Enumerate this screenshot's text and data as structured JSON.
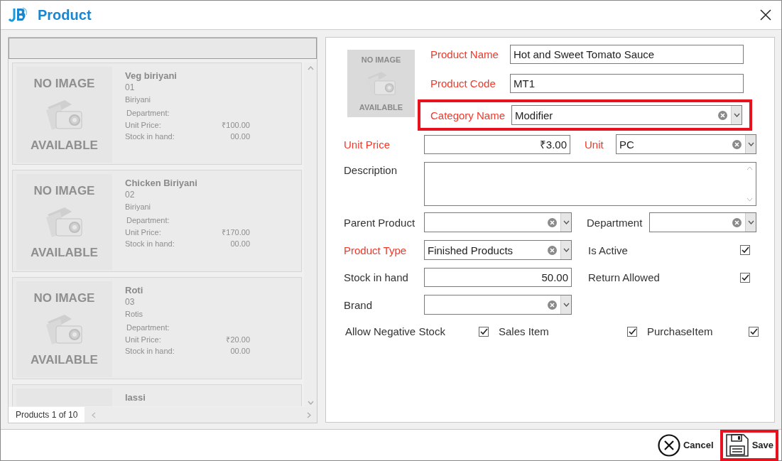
{
  "window": {
    "title": "Product"
  },
  "product_list": {
    "items": [
      {
        "name": "Veg biriyani",
        "code": "01",
        "category": "Biriyani",
        "department_label": "Department:",
        "unit_price_label": "Unit Price:",
        "unit_price": "₹100.00",
        "stock_label": "Stock in hand:",
        "stock": "00.00",
        "image_text": [
          "NO IMAGE",
          "AVAILABLE"
        ]
      },
      {
        "name": "Chicken Biriyani",
        "code": "02",
        "category": "Biriyani",
        "department_label": "Department:",
        "unit_price_label": "Unit Price:",
        "unit_price": "₹170.00",
        "stock_label": "Stock in hand:",
        "stock": "00.00",
        "image_text": [
          "NO IMAGE",
          "AVAILABLE"
        ]
      },
      {
        "name": "Roti",
        "code": "03",
        "category": "Rotis",
        "department_label": "Department:",
        "unit_price_label": "Unit Price:",
        "unit_price": "₹20.00",
        "stock_label": "Stock in hand:",
        "stock": "00.00",
        "image_text": [
          "NO IMAGE",
          "AVAILABLE"
        ]
      },
      {
        "name": "lassi"
      }
    ],
    "pager": "Products 1 of 10"
  },
  "form": {
    "photo_text": [
      "NO IMAGE",
      "AVAILABLE"
    ],
    "product_name": {
      "label": "Product Name",
      "value": "Hot and Sweet Tomato Sauce",
      "required": true
    },
    "product_code": {
      "label": "Product Code",
      "value": "MT1",
      "required": true
    },
    "category_name": {
      "label": "Category Name",
      "value": "Modifier",
      "required": true,
      "highlighted": true
    },
    "unit_price": {
      "label": "Unit Price",
      "value": "₹3.00",
      "required": true
    },
    "unit": {
      "label": "Unit",
      "value": "PC",
      "required": true
    },
    "description": {
      "label": "Description",
      "required": false
    },
    "parent_product": {
      "label": "Parent Product",
      "required": false
    },
    "department": {
      "label": "Department",
      "required": false
    },
    "product_type": {
      "label": "Product Type",
      "value": "Finished Products",
      "required": true
    },
    "is_active": {
      "label": "Is Active",
      "checked": true
    },
    "stock_in_hand": {
      "label": "Stock in hand",
      "value": "50.00",
      "required": false
    },
    "return_allowed": {
      "label": "Return Allowed",
      "checked": true
    },
    "brand": {
      "label": "Brand",
      "required": false
    },
    "allow_negative_stock": {
      "label": "Allow Negative Stock",
      "checked": true
    },
    "sales_item": {
      "label": "Sales Item",
      "checked": true
    },
    "purchase_item": {
      "label": "PurchaseItem",
      "checked": true
    }
  },
  "footer": {
    "buttons": [
      {
        "kind": "cancel",
        "label": "Cancel",
        "highlighted": false
      },
      {
        "kind": "save",
        "label": "Save",
        "highlighted": true
      }
    ]
  }
}
